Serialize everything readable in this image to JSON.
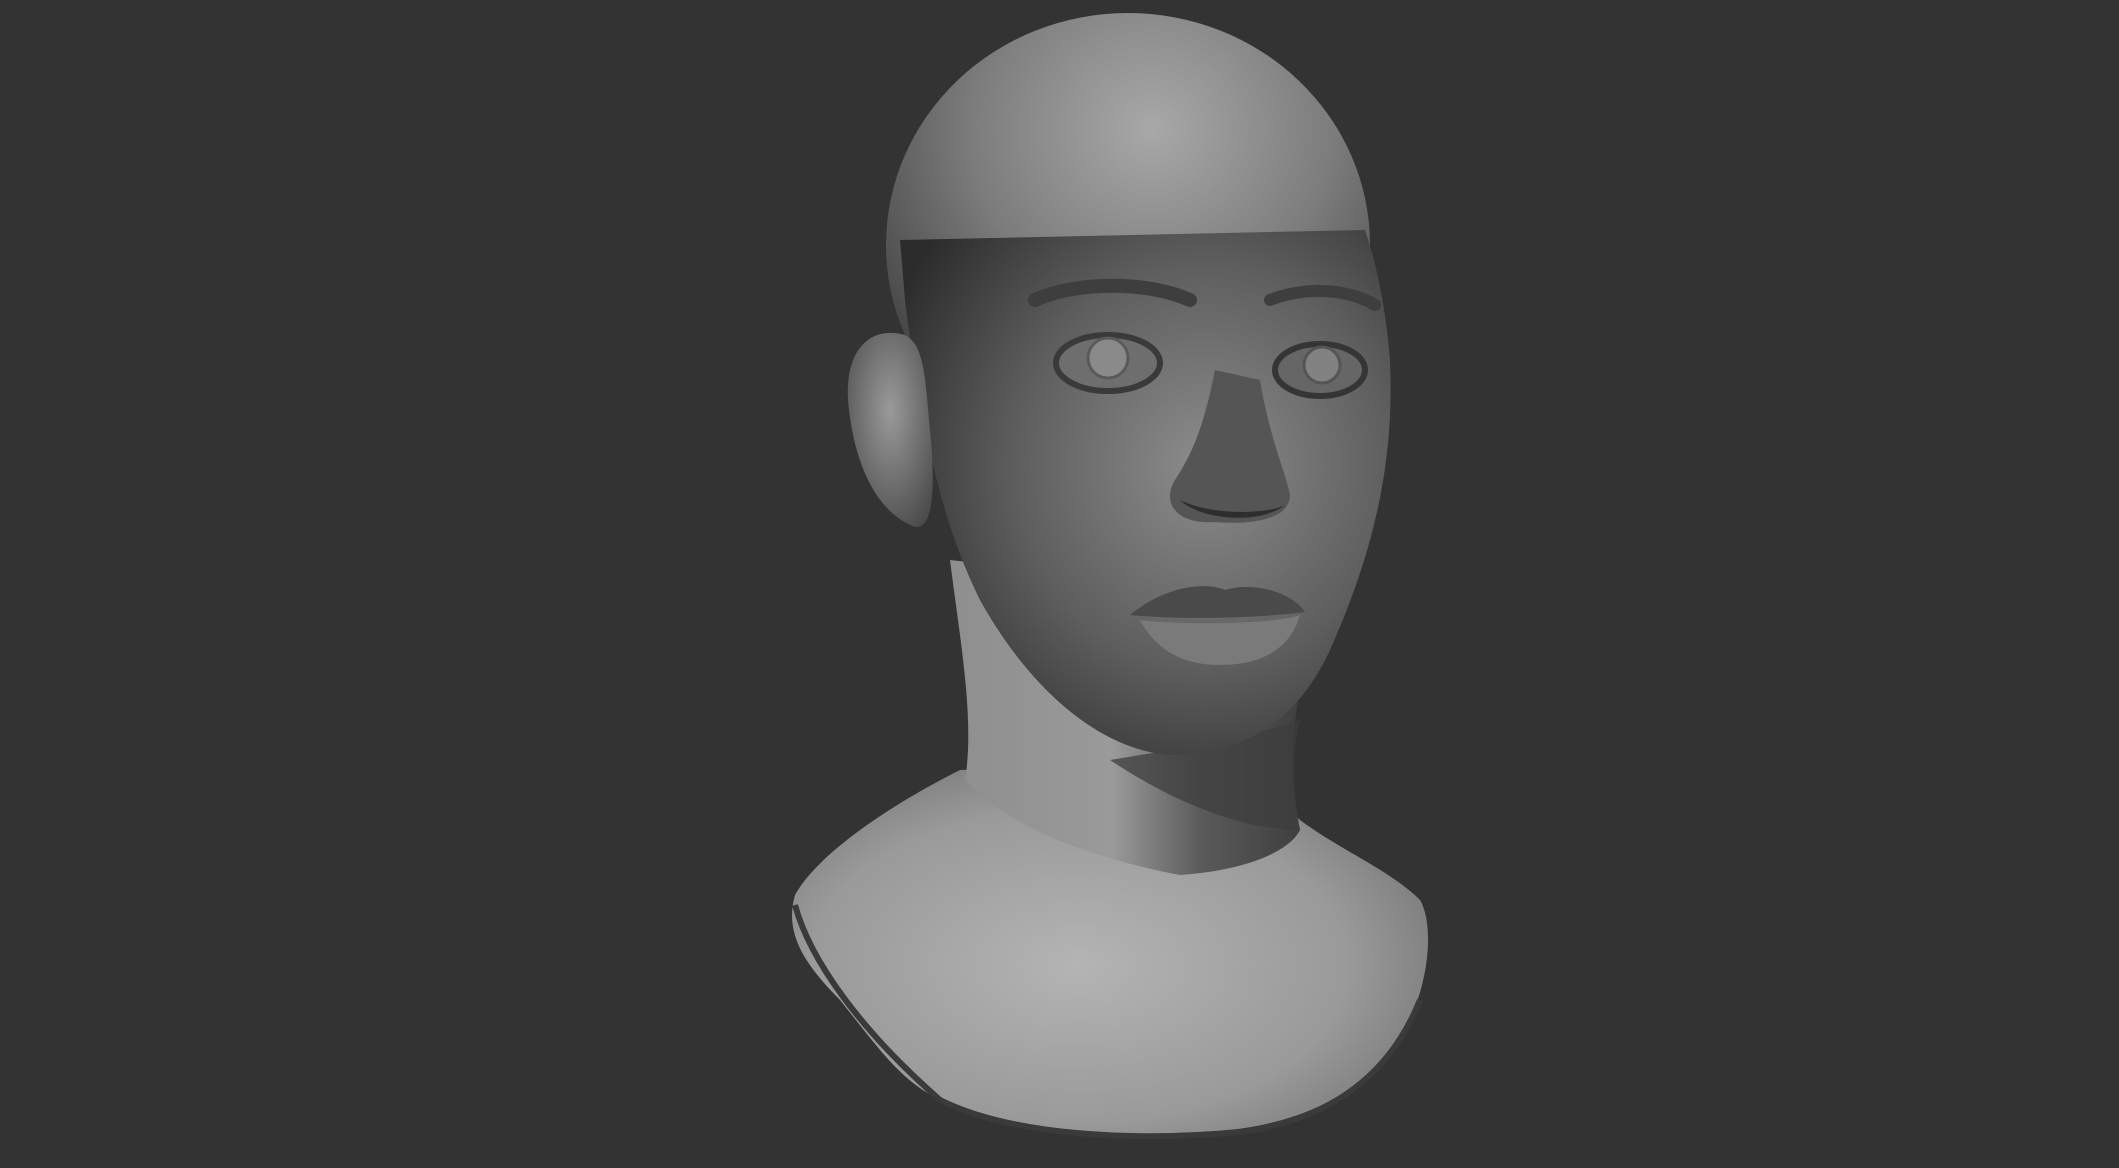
{
  "scene": {
    "subject": "sculpted-head-bust",
    "background_color": "#333333",
    "material_light": "#b8b8b8",
    "material_mid": "#7a7a7a",
    "material_dark": "#2e2e2e"
  }
}
